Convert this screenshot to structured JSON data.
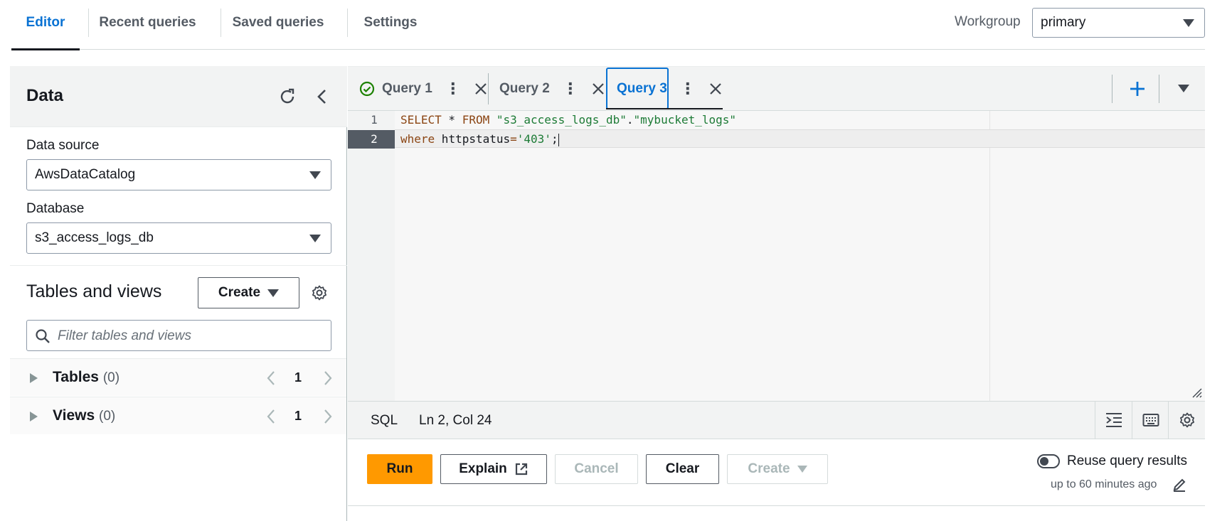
{
  "nav": {
    "tabs": [
      {
        "label": "Editor"
      },
      {
        "label": "Recent queries"
      },
      {
        "label": "Saved queries"
      },
      {
        "label": "Settings"
      }
    ],
    "active_tab": "Editor",
    "workgroup_label": "Workgroup",
    "workgroup_value": "primary"
  },
  "left_panel": {
    "title": "Data",
    "data_source_label": "Data source",
    "data_source_value": "AwsDataCatalog",
    "database_label": "Database",
    "database_value": "s3_access_logs_db",
    "tables_views_title": "Tables and views",
    "create_label": "Create",
    "filter_placeholder": "Filter tables and views",
    "rows": [
      {
        "name": "Tables",
        "count": "(0)",
        "page": "1"
      },
      {
        "name": "Views",
        "count": "(0)",
        "page": "1"
      }
    ]
  },
  "editor": {
    "query_tabs": [
      {
        "label": "Query 1",
        "status": "success"
      },
      {
        "label": "Query 2",
        "status": ""
      },
      {
        "label": "Query 3",
        "status": "active"
      }
    ],
    "line_numbers": [
      "1",
      "2"
    ],
    "code_lines": [
      {
        "kw1": "SELECT",
        "mid1": " * ",
        "kw2": "FROM",
        "str1": " \"s3_access_logs_db\"",
        "dot": ".",
        "str2": "\"mybucket_logs\""
      },
      {
        "kw1": "where",
        "mid1": " httpstatus",
        "kw2": "=",
        "str1": "'403'",
        "dot": ";",
        "str2": ""
      }
    ],
    "language": "SQL",
    "cursor_position": "Ln 2, Col 24"
  },
  "actions": {
    "run_label": "Run",
    "explain_label": "Explain",
    "cancel_label": "Cancel",
    "clear_label": "Clear",
    "create_label": "Create",
    "reuse_label": "Reuse query results",
    "reuse_sub": "up to 60 minutes ago"
  },
  "colors": {
    "accent": "#0972d3",
    "run_button": "#ff9900",
    "success": "#1d8102"
  }
}
